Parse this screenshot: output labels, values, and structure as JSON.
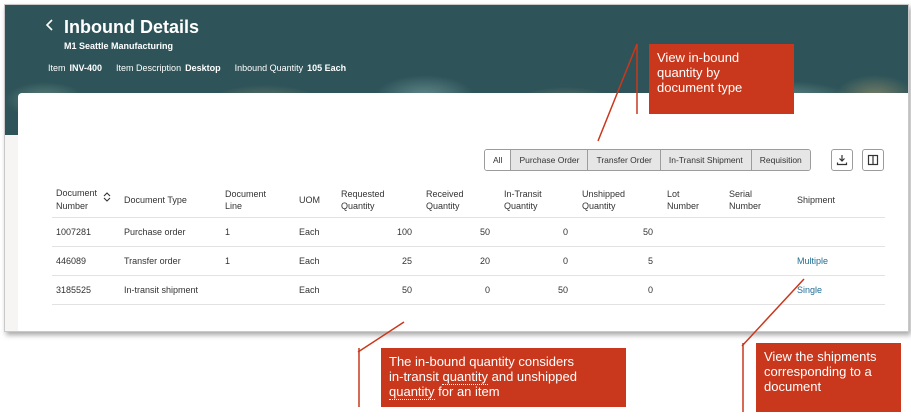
{
  "header": {
    "back_icon": "chevron-left-icon",
    "title": "Inbound Details",
    "subtitle": "M1 Seattle Manufacturing",
    "meta": [
      {
        "label": "Item",
        "value": "INV-400"
      },
      {
        "label": "Item Description",
        "value": "Desktop"
      },
      {
        "label": "Inbound Quantity",
        "value": "105 Each"
      }
    ]
  },
  "filters": [
    "All",
    "Purchase Order",
    "Transfer Order",
    "In-Transit Shipment",
    "Requisition"
  ],
  "toolbar": {
    "download_icon": "download-icon",
    "columns_icon": "columns-icon"
  },
  "table": {
    "columns": [
      {
        "l1": "Document",
        "l2": "Number"
      },
      {
        "l1": "Document Type",
        "l2": ""
      },
      {
        "l1": "Document",
        "l2": "Line"
      },
      {
        "l1": "UOM",
        "l2": ""
      },
      {
        "l1": "Requested",
        "l2": "Quantity"
      },
      {
        "l1": "Received",
        "l2": "Quantity"
      },
      {
        "l1": "In-Transit",
        "l2": "Quantity"
      },
      {
        "l1": "Unshipped",
        "l2": "Quantity"
      },
      {
        "l1": "Lot",
        "l2": "Number"
      },
      {
        "l1": "Serial",
        "l2": "Number"
      },
      {
        "l1": "Shipment",
        "l2": ""
      }
    ],
    "rows": [
      {
        "doc_number": "1007281",
        "doc_type": "Purchase order",
        "line": "1",
        "uom": "Each",
        "requested": "100",
        "received": "50",
        "in_transit": "0",
        "unshipped": "50",
        "lot": "",
        "serial": "",
        "shipment": ""
      },
      {
        "doc_number": "446089",
        "doc_type": "Transfer order",
        "line": "1",
        "uom": "Each",
        "requested": "25",
        "received": "20",
        "in_transit": "0",
        "unshipped": "5",
        "lot": "",
        "serial": "",
        "shipment": "Multiple"
      },
      {
        "doc_number": "3185525",
        "doc_type": "In-transit shipment",
        "line": "",
        "uom": "Each",
        "requested": "50",
        "received": "0",
        "in_transit": "50",
        "unshipped": "0",
        "lot": "",
        "serial": "",
        "shipment": "Single"
      }
    ]
  },
  "callouts": {
    "top": {
      "l1": "View in-bound",
      "l2": "quantity by",
      "l3": "document type"
    },
    "bottom_left": {
      "l1": "The in-bound quantity considers",
      "l2a": "in-transit ",
      "l2b": "quantity",
      "l2c": " and unshipped",
      "l3a": "quantity",
      "l3b": " for an item"
    },
    "bottom_right": {
      "l1": "View the shipments",
      "l2": "corresponding to a",
      "l3": "document"
    }
  },
  "colors": {
    "header_bg": "#2e5459",
    "callout_bg": "#c9381c",
    "link": "#1f6d95"
  }
}
